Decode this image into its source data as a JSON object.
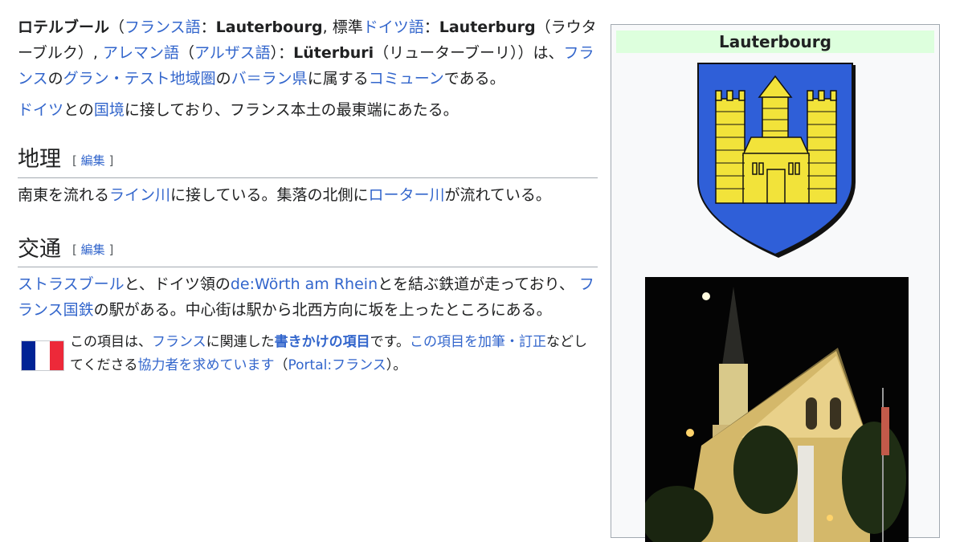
{
  "intro": {
    "p1": {
      "name_bold": "ロテルブール",
      "t1": "（",
      "french_lang": "フランス語",
      "t2": "：",
      "french_name": "Lauterbourg",
      "t3": ", 標準",
      "german_lang": "ドイツ語",
      "t4": "：",
      "german_name": "Lauterburg",
      "t5": "（ラウターブルク）, ",
      "alemannic_lang": "アレマン語",
      "t6": "（",
      "alsatian_lang": "アルザス語",
      "t7": "）：",
      "alsatian_name": "Lüterburi",
      "t8": "（リューターブーリ））は、",
      "france": "フランス",
      "t9": "の",
      "grand_est": "グラン・テスト地域圏",
      "t10": "の",
      "bas_rhin": "バ＝ラン県",
      "t11": "に属する",
      "commune": "コミューン",
      "t12": "である。"
    },
    "p2": {
      "germany": "ドイツ",
      "t1": "との",
      "border": "国境",
      "t2": "に接しており、フランス本土の最東端にあたる。"
    }
  },
  "sections": {
    "geography": {
      "heading": "地理",
      "edit_open": "[",
      "edit_label": "編集",
      "edit_close": "]",
      "t1": "南東を流れる",
      "rhine": "ライン川",
      "t2": "に接している。集落の北側に",
      "lauter": "ローター川",
      "t3": "が流れている。"
    },
    "transport": {
      "heading": "交通",
      "edit_open": "[",
      "edit_label": "編集",
      "edit_close": "]",
      "strasbourg": "ストラスブール",
      "t1": "と、ドイツ領の",
      "worth": "de:Wörth am Rhein",
      "t2": "とを結ぶ鉄道が走っており、 ",
      "sncf": "フランス国鉄",
      "t3": "の駅がある。中心街は駅から北西方向に坂を上ったところにある。"
    }
  },
  "stub": {
    "t1": "この項目は、",
    "france": "フランス",
    "t2": "に関連した",
    "stub_link": "書きかけの項目",
    "t3": "です。",
    "edit_link": "この項目を加筆・訂正",
    "t4": "などしてくださる",
    "help_link": "協力者を求めています",
    "t5": "（",
    "portal": "Portal:フランス",
    "t6": "）。",
    "flag_colors": [
      "#002395",
      "#ffffff",
      "#ed2939"
    ]
  },
  "infobox": {
    "title": "Lauterbourg",
    "coat_of_arms_colors": {
      "field": "#2f5fd8",
      "castle": "#f2e33a",
      "outline": "#111111"
    }
  },
  "colors": {
    "link": "#3366cc",
    "text": "#202122",
    "infobox_title_bg": "#ddffdd"
  }
}
